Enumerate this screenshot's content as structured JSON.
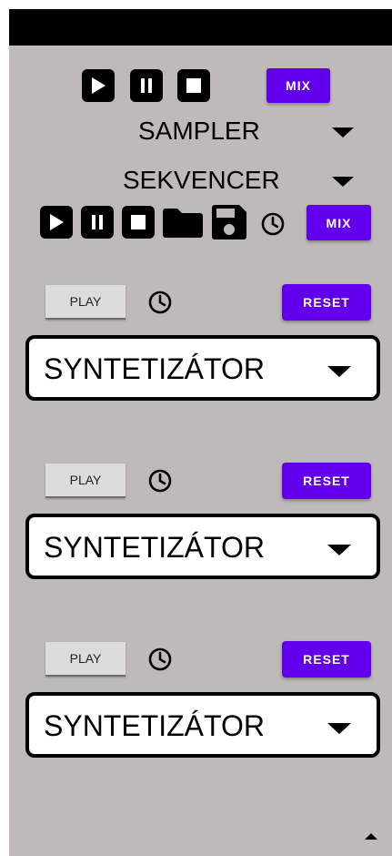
{
  "sampler_transport": {
    "mix_label": "MIX"
  },
  "sampler": {
    "label": "SAMPLER"
  },
  "sequencer": {
    "label": "SEKVENCER",
    "mix_label": "MIX"
  },
  "synths": [
    {
      "play_label": "PLAY",
      "reset_label": "RESET",
      "select_value": "SYNTETIZÁTOR"
    },
    {
      "play_label": "PLAY",
      "reset_label": "RESET",
      "select_value": "SYNTETIZÁTOR"
    },
    {
      "play_label": "PLAY",
      "reset_label": "RESET",
      "select_value": "SYNTETIZÁTOR"
    }
  ],
  "colors": {
    "accent": "#6200ee",
    "background": "#bfbaba",
    "status_bar": "#000000"
  },
  "icons": [
    "play-icon",
    "pause-icon",
    "stop-icon",
    "folder-icon",
    "save-icon",
    "clock-icon",
    "chevron-down-icon",
    "scroll-up-icon"
  ]
}
